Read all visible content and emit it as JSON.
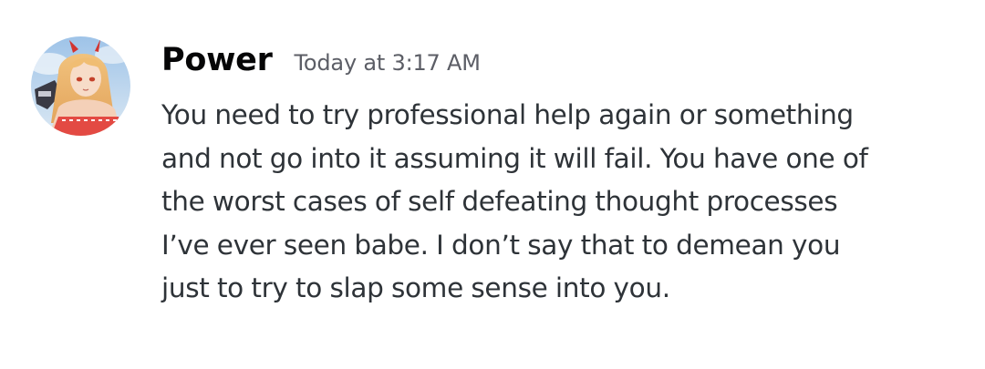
{
  "message": {
    "author": "Power",
    "timestamp": "Today at 3:17 AM",
    "avatar_icon": "anime-character-avatar",
    "lines": [
      "You need to try professional help again or something",
      "and not go into it assuming it will fail. You have one of",
      "the worst cases of self defeating thought processes",
      "I’ve ever seen babe. I don’t say that to demean you",
      "just to try to slap some sense into you."
    ]
  },
  "colors": {
    "background": "#ffffff",
    "username": "#060607",
    "timestamp": "#5c5e66",
    "text": "#2e3338"
  }
}
